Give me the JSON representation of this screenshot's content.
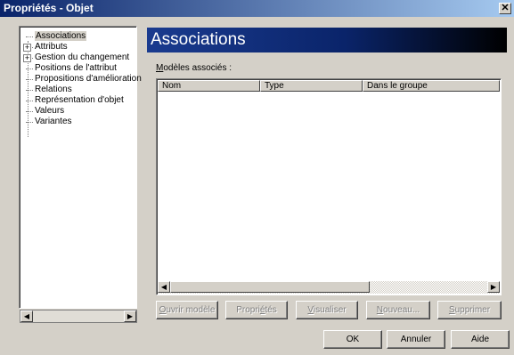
{
  "window": {
    "title": "Propriétés - Objet",
    "close_glyph": "✕"
  },
  "tree": {
    "items": [
      {
        "label": "Associations",
        "expandable": false,
        "selected": true
      },
      {
        "label": "Attributs",
        "expandable": true,
        "selected": false
      },
      {
        "label": "Gestion du changement",
        "expandable": true,
        "selected": false
      },
      {
        "label": "Positions de l'attribut",
        "expandable": false,
        "selected": false
      },
      {
        "label": "Propositions d'amélioration",
        "expandable": false,
        "selected": false
      },
      {
        "label": "Relations",
        "expandable": false,
        "selected": false
      },
      {
        "label": "Représentation d'objet",
        "expandable": false,
        "selected": false
      },
      {
        "label": "Valeurs",
        "expandable": false,
        "selected": false
      },
      {
        "label": "Variantes",
        "expandable": false,
        "selected": false
      }
    ],
    "expander_glyph": "+"
  },
  "panel": {
    "header": "Associations",
    "section_label_prefix": "M",
    "section_label_rest": "odèles associés :",
    "columns": [
      "Nom",
      "Type",
      "Dans le groupe"
    ]
  },
  "scroll": {
    "left_glyph": "◀",
    "right_glyph": "▶"
  },
  "actions": {
    "open_model": {
      "u": "O",
      "rest": "uvrir modèle"
    },
    "properties": {
      "pre": "Propri",
      "u": "é",
      "rest": "tés"
    },
    "visualize": {
      "u": "V",
      "rest": "isualiser"
    },
    "new": {
      "u": "N",
      "rest": "ouveau..."
    },
    "delete": {
      "u": "S",
      "rest": "upprimer"
    }
  },
  "dialog": {
    "ok": "OK",
    "cancel": "Annuler",
    "help": "Aide"
  }
}
